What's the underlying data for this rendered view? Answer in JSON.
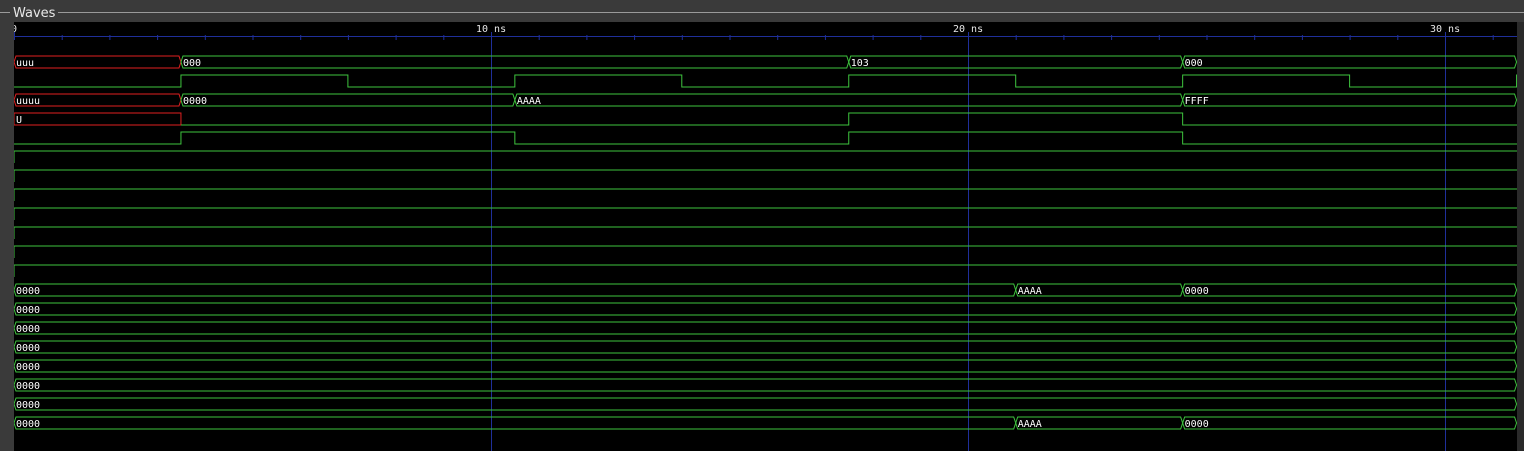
{
  "panel": {
    "title": "Waves"
  },
  "time_axis": {
    "unit": "ns",
    "ticks": [
      {
        "value": 0,
        "label": "0"
      },
      {
        "value": 10,
        "label": "10 ns"
      },
      {
        "value": 20,
        "label": "20 ns"
      },
      {
        "value": 30,
        "label": "30 ns"
      }
    ]
  },
  "colors": {
    "background": "#000000",
    "wave": "#3ec43e",
    "undefined": "#e02020",
    "grid": "#1f2f9a",
    "panel": "#3a3a3a"
  },
  "signals": [
    {
      "kind": "bus",
      "segments": [
        {
          "from": 0,
          "to": 3.5,
          "value": "uuu",
          "undefined": true
        },
        {
          "from": 3.5,
          "to": 17.5,
          "value": "000"
        },
        {
          "from": 17.5,
          "to": 24.5,
          "value": "103"
        },
        {
          "from": 24.5,
          "to": 31.5,
          "value": "000"
        }
      ]
    },
    {
      "kind": "bit",
      "initial": 0,
      "edges": [
        3.5,
        7,
        10.5,
        14,
        17.5,
        21,
        24.5,
        28,
        31.5
      ]
    },
    {
      "kind": "bus",
      "segments": [
        {
          "from": 0,
          "to": 3.5,
          "value": "uuuu",
          "undefined": true
        },
        {
          "from": 3.5,
          "to": 10.5,
          "value": "0000"
        },
        {
          "from": 10.5,
          "to": 24.5,
          "value": "AAAA"
        },
        {
          "from": 24.5,
          "to": 31.5,
          "value": "FFFF"
        }
      ]
    },
    {
      "kind": "bit",
      "initial": "U",
      "undefined_until": 3.5,
      "label": "U",
      "edges": [
        3.5,
        17.5,
        24.5
      ]
    },
    {
      "kind": "bit",
      "initial": 0,
      "edges": [
        3.5,
        10.5,
        17.5,
        24.5
      ]
    },
    {
      "kind": "bit",
      "initial": 0,
      "edges": [
        0
      ]
    },
    {
      "kind": "bit",
      "initial": 0,
      "edges": [
        0
      ]
    },
    {
      "kind": "bit",
      "initial": 0,
      "edges": [
        0
      ]
    },
    {
      "kind": "bit",
      "initial": 0,
      "edges": [
        0
      ]
    },
    {
      "kind": "bit",
      "initial": 0,
      "edges": [
        0
      ]
    },
    {
      "kind": "bit",
      "initial": 0,
      "edges": [
        0
      ]
    },
    {
      "kind": "bit",
      "initial": 0,
      "edges": [
        0
      ]
    },
    {
      "kind": "bus",
      "segments": [
        {
          "from": 0,
          "to": 21,
          "value": "0000"
        },
        {
          "from": 21,
          "to": 24.5,
          "value": "AAAA"
        },
        {
          "from": 24.5,
          "to": 31.5,
          "value": "0000"
        }
      ]
    },
    {
      "kind": "bus",
      "segments": [
        {
          "from": 0,
          "to": 31.5,
          "value": "0000"
        }
      ]
    },
    {
      "kind": "bus",
      "segments": [
        {
          "from": 0,
          "to": 31.5,
          "value": "0000"
        }
      ]
    },
    {
      "kind": "bus",
      "segments": [
        {
          "from": 0,
          "to": 31.5,
          "value": "0000"
        }
      ]
    },
    {
      "kind": "bus",
      "segments": [
        {
          "from": 0,
          "to": 31.5,
          "value": "0000"
        }
      ]
    },
    {
      "kind": "bus",
      "segments": [
        {
          "from": 0,
          "to": 31.5,
          "value": "0000"
        }
      ]
    },
    {
      "kind": "bus",
      "segments": [
        {
          "from": 0,
          "to": 31.5,
          "value": "0000"
        }
      ]
    },
    {
      "kind": "bus",
      "segments": [
        {
          "from": 0,
          "to": 21,
          "value": "0000"
        },
        {
          "from": 21,
          "to": 24.5,
          "value": "AAAA"
        },
        {
          "from": 24.5,
          "to": 31.5,
          "value": "0000"
        }
      ]
    }
  ]
}
